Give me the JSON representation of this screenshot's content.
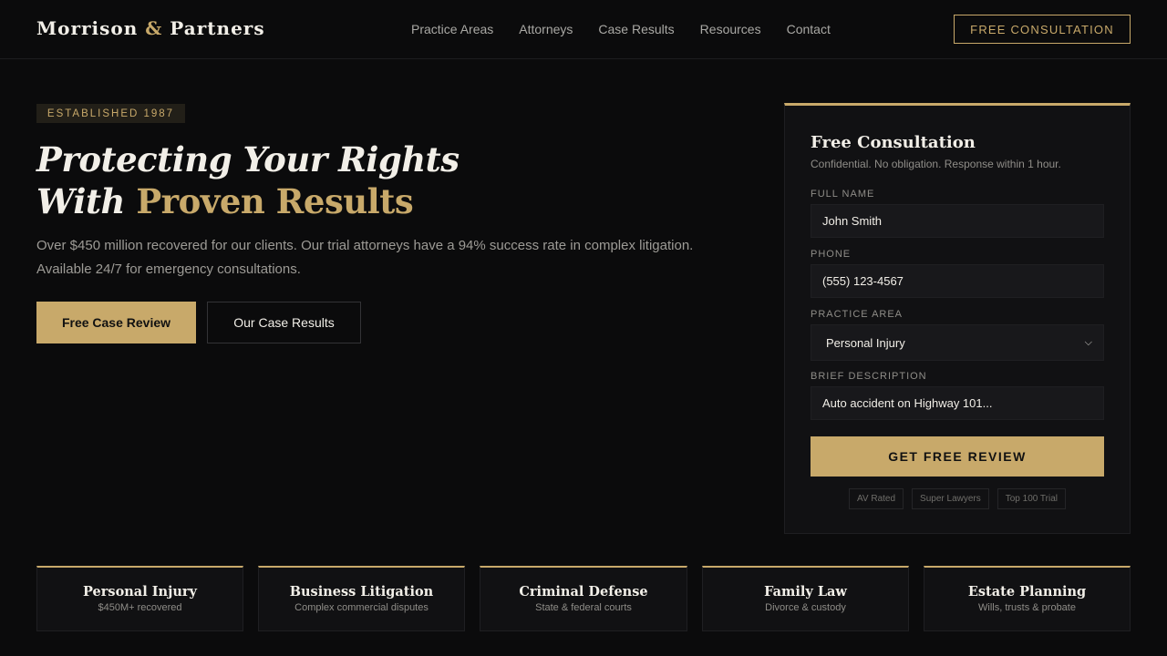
{
  "brand": {
    "name_part1": "Morrison",
    "ampersand": "&",
    "name_part2": "Partners"
  },
  "nav": {
    "items": [
      "Practice Areas",
      "Attorneys",
      "Case Results",
      "Resources",
      "Contact"
    ],
    "cta": "FREE CONSULTATION"
  },
  "hero": {
    "badge": "ESTABLISHED 1987",
    "title_line1": "Protecting Your Rights",
    "title_line2_prefix": "With",
    "title_line2_highlight": "Proven Results",
    "subtitle": "Over $450 million recovered for our clients. Our trial attorneys have a 94% success rate in complex litigation. Available 24/7 for emergency consultations.",
    "primary_button": "Free Case Review",
    "secondary_button": "Our Case Results"
  },
  "form": {
    "title": "Free Consultation",
    "subtitle": "Confidential. No obligation. Response within 1 hour.",
    "name_label": "FULL NAME",
    "name_value": "John Smith",
    "phone_label": "PHONE",
    "phone_value": "(555) 123-4567",
    "practice_label": "PRACTICE AREA",
    "practice_value": "Personal Injury",
    "description_label": "BRIEF DESCRIPTION",
    "description_value": "Auto accident on Highway 101...",
    "submit": "GET FREE REVIEW",
    "trust_badges": [
      "AV Rated",
      "Super Lawyers",
      "Top 100 Trial"
    ]
  },
  "practice_areas": [
    {
      "title": "Personal Injury",
      "subtitle": "$450M+ recovered"
    },
    {
      "title": "Business Litigation",
      "subtitle": "Complex commercial disputes"
    },
    {
      "title": "Criminal Defense",
      "subtitle": "State & federal courts"
    },
    {
      "title": "Family Law",
      "subtitle": "Divorce & custody"
    },
    {
      "title": "Estate Planning",
      "subtitle": "Wills, trusts & probate"
    }
  ],
  "colors": {
    "accent": "#c8a96a",
    "background": "#0b0b0c",
    "card": "#111113"
  }
}
